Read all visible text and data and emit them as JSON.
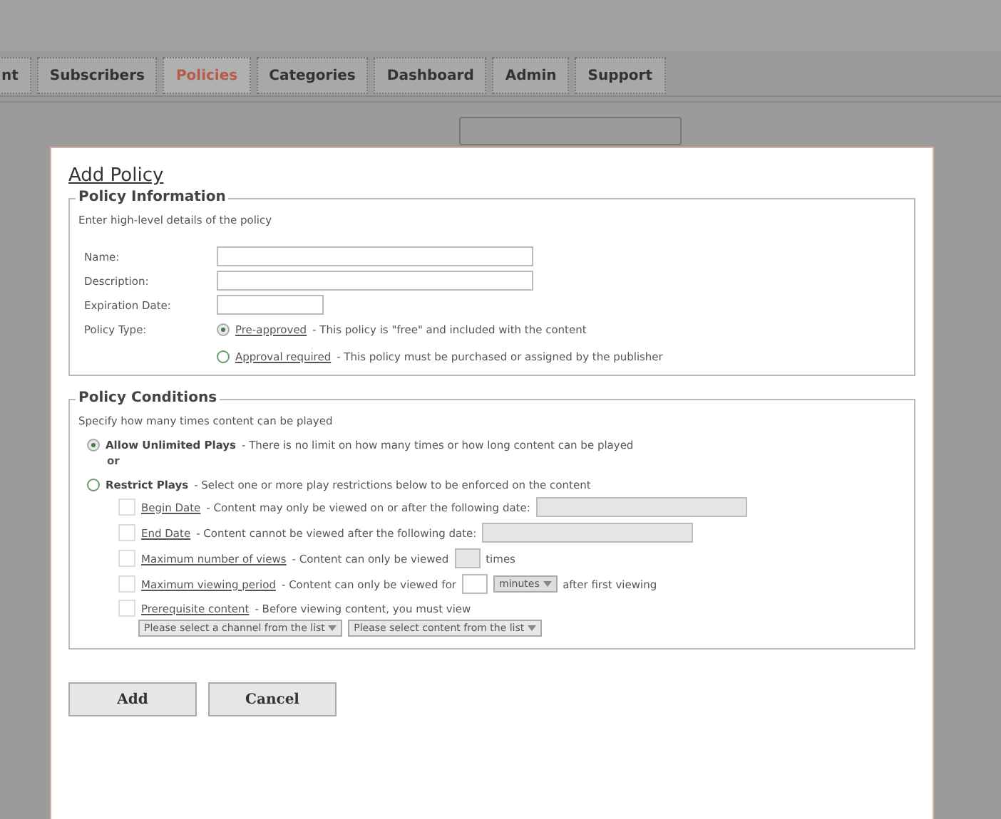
{
  "tabs": [
    {
      "label": "nt",
      "selected": false
    },
    {
      "label": "Subscribers",
      "selected": false
    },
    {
      "label": "Policies",
      "selected": true
    },
    {
      "label": "Categories",
      "selected": false
    },
    {
      "label": "Dashboard",
      "selected": false
    },
    {
      "label": "Admin",
      "selected": false
    },
    {
      "label": "Support",
      "selected": false
    }
  ],
  "dialog": {
    "title": "Add Policy",
    "information": {
      "legend": "Policy Information",
      "description": "Enter high-level details of the policy",
      "fields": [
        {
          "label": "Name:",
          "kind": "long"
        },
        {
          "label": "Description:",
          "kind": "long"
        },
        {
          "label": "Expiration Date:",
          "kind": "short"
        }
      ],
      "policy_type": {
        "label": "Policy Type:",
        "options": [
          {
            "link": "Pre-approved",
            "text": "- This policy is \"free\" and included with the content",
            "selected": true
          },
          {
            "link": "Approval required",
            "text": "- This policy must be purchased or assigned by the publisher",
            "selected": false
          }
        ]
      }
    },
    "conditions": {
      "legend": "Policy Conditions",
      "description": "Specify how many times content can be played",
      "modes": [
        {
          "label": "Allow Unlimited Plays",
          "text": "- There is no limit on how many times or how long content can be played",
          "selected": true
        },
        {
          "label": "Restrict Plays",
          "text": "- Select one or more play restrictions below to be enforced on the content",
          "selected": false
        }
      ],
      "separator": "or",
      "restrictions": [
        {
          "kind": "date",
          "link": "Begin Date",
          "text": "- Content may only be viewed on or after the following date:",
          "checked": false
        },
        {
          "kind": "date",
          "link": "End Date",
          "text": "- Content cannot be viewed after the following date:",
          "checked": false
        },
        {
          "kind": "count",
          "link": "Maximum number of views",
          "text": "- Content can only be viewed",
          "suffix": "times",
          "checked": false
        },
        {
          "kind": "period",
          "link": "Maximum viewing period",
          "text": "- Content can only be viewed for",
          "unit": "minutes",
          "suffix": "after first viewing",
          "checked": false
        },
        {
          "kind": "prerequisite",
          "link": "Prerequisite content",
          "text": "- Before viewing content, you must view",
          "selects": [
            "Please select a channel from the list",
            "Please select content from the list"
          ],
          "checked": false
        }
      ]
    },
    "buttons": [
      "Add",
      "Cancel"
    ]
  }
}
